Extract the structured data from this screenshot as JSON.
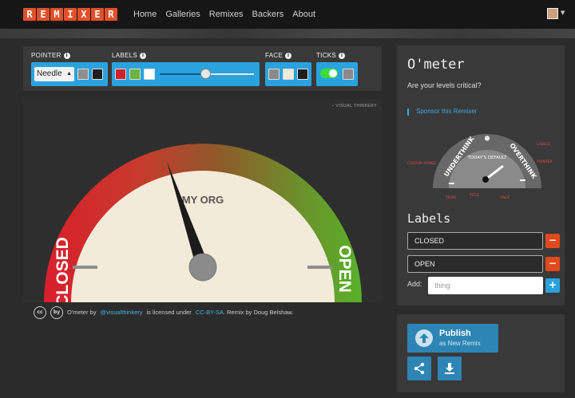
{
  "nav": {
    "logo_letters": [
      "R",
      "E",
      "M",
      "I",
      "X",
      "E",
      "R"
    ],
    "links": [
      "Home",
      "Galleries",
      "Remixes",
      "Backers",
      "About"
    ]
  },
  "toolbar": {
    "pointer": {
      "label": "POINTER",
      "select_value": "Needle"
    },
    "labels": {
      "label": "LABELS",
      "slider_fraction": 0.48
    },
    "face": {
      "label": "FACE"
    },
    "ticks": {
      "label": "TICKS",
      "toggle_on": true
    }
  },
  "gauge": {
    "center_text": "MY ORG",
    "left_label": "CLOSED",
    "right_label": "OPEN",
    "watermark": "VISUAL THINKERY",
    "needle_fraction": 0.35
  },
  "credit": {
    "cc_badge": "cc",
    "by_badge": "by",
    "prefix": "O'meter by",
    "author": "@visualthinkery",
    "middle": "is licensed under",
    "license": "CC-BY-SA",
    "suffix": ". Remix by Doug Belshaw."
  },
  "sidebar": {
    "title": "O'meter",
    "subtitle": "Are your levels critical?",
    "sponsor": "Sponsor this Remixer",
    "diagram": {
      "underthink": "UNDERTHINK",
      "overthink": "OVERTHINK",
      "default": "TODAY'S DEFAULT",
      "colour_range": "COLOUR RANGE",
      "labels": "LABELS",
      "pointer": "POINTER",
      "ticks": "TICKS",
      "title": "TITLE",
      "face": "FACE"
    },
    "labels_heading": "Labels",
    "label_values": [
      "CLOSED",
      "OPEN"
    ],
    "minus": "−",
    "add_label": "Add:",
    "add_placeholder": "thing",
    "plus": "+"
  },
  "publish": {
    "title": "Publish",
    "subtitle": "as New Remix"
  },
  "colors": {
    "accent": "#2aa2de",
    "danger": "#e24a1d",
    "logo": "#e2502a"
  }
}
